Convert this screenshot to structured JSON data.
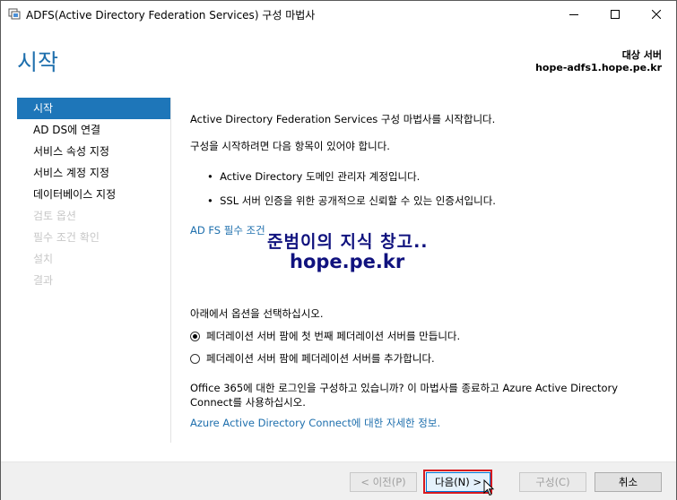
{
  "window": {
    "title": "ADFS(Active Directory Federation Services) 구성 마법사"
  },
  "header": {
    "page_title": "시작",
    "target_label": "대상 서버",
    "target_server": "hope-adfs1.hope.pe.kr"
  },
  "sidebar": {
    "items": [
      {
        "label": "시작",
        "state": "active"
      },
      {
        "label": "AD DS에 연결",
        "state": "enabled"
      },
      {
        "label": "서비스 속성 지정",
        "state": "enabled"
      },
      {
        "label": "서비스 계정 지정",
        "state": "enabled"
      },
      {
        "label": "데이터베이스 지정",
        "state": "enabled"
      },
      {
        "label": "검토 옵션",
        "state": "disabled"
      },
      {
        "label": "필수 조건 확인",
        "state": "disabled"
      },
      {
        "label": "설치",
        "state": "disabled"
      },
      {
        "label": "결과",
        "state": "disabled"
      }
    ]
  },
  "main": {
    "intro": "Active Directory Federation Services 구성 마법사를 시작합니다.",
    "requirements_intro": "구성을 시작하려면 다음 항목이 있어야 합니다.",
    "requirements": [
      "Active Directory 도메인 관리자 계정입니다.",
      "SSL 서버 인증을 위한 공개적으로 신뢰할 수 있는 인증서입니다."
    ],
    "prereq_link": "AD FS 필수 조건",
    "options_intro": "아래에서 옵션을 선택하십시오.",
    "options": [
      {
        "label": "페더레이션 서버 팜에 첫 번째 페더레이션 서버를 만듭니다.",
        "checked": true
      },
      {
        "label": "페더레이션 서버 팜에 페더레이션 서버를 추가합니다.",
        "checked": false
      }
    ],
    "office_note_line1": "Office 365에 대한 로그인을 구성하고 있습니까? 이 마법사를 종료하고 Azure Active Directory",
    "office_note_line2": "Connect를 사용하십시오.",
    "azure_link": "Azure Active Directory Connect에 대한 자세한 정보."
  },
  "watermark": {
    "line1": "준범이의 지식 창고..",
    "line2": "hope.pe.kr"
  },
  "footer": {
    "prev": "< 이전(P)",
    "next": "다음(N) >",
    "configure": "구성(C)",
    "cancel": "취소"
  },
  "colors": {
    "accent": "#1e76b9",
    "title_blue": "#1e6fad",
    "highlight_red": "#d7191f",
    "watermark": "#10127e"
  }
}
